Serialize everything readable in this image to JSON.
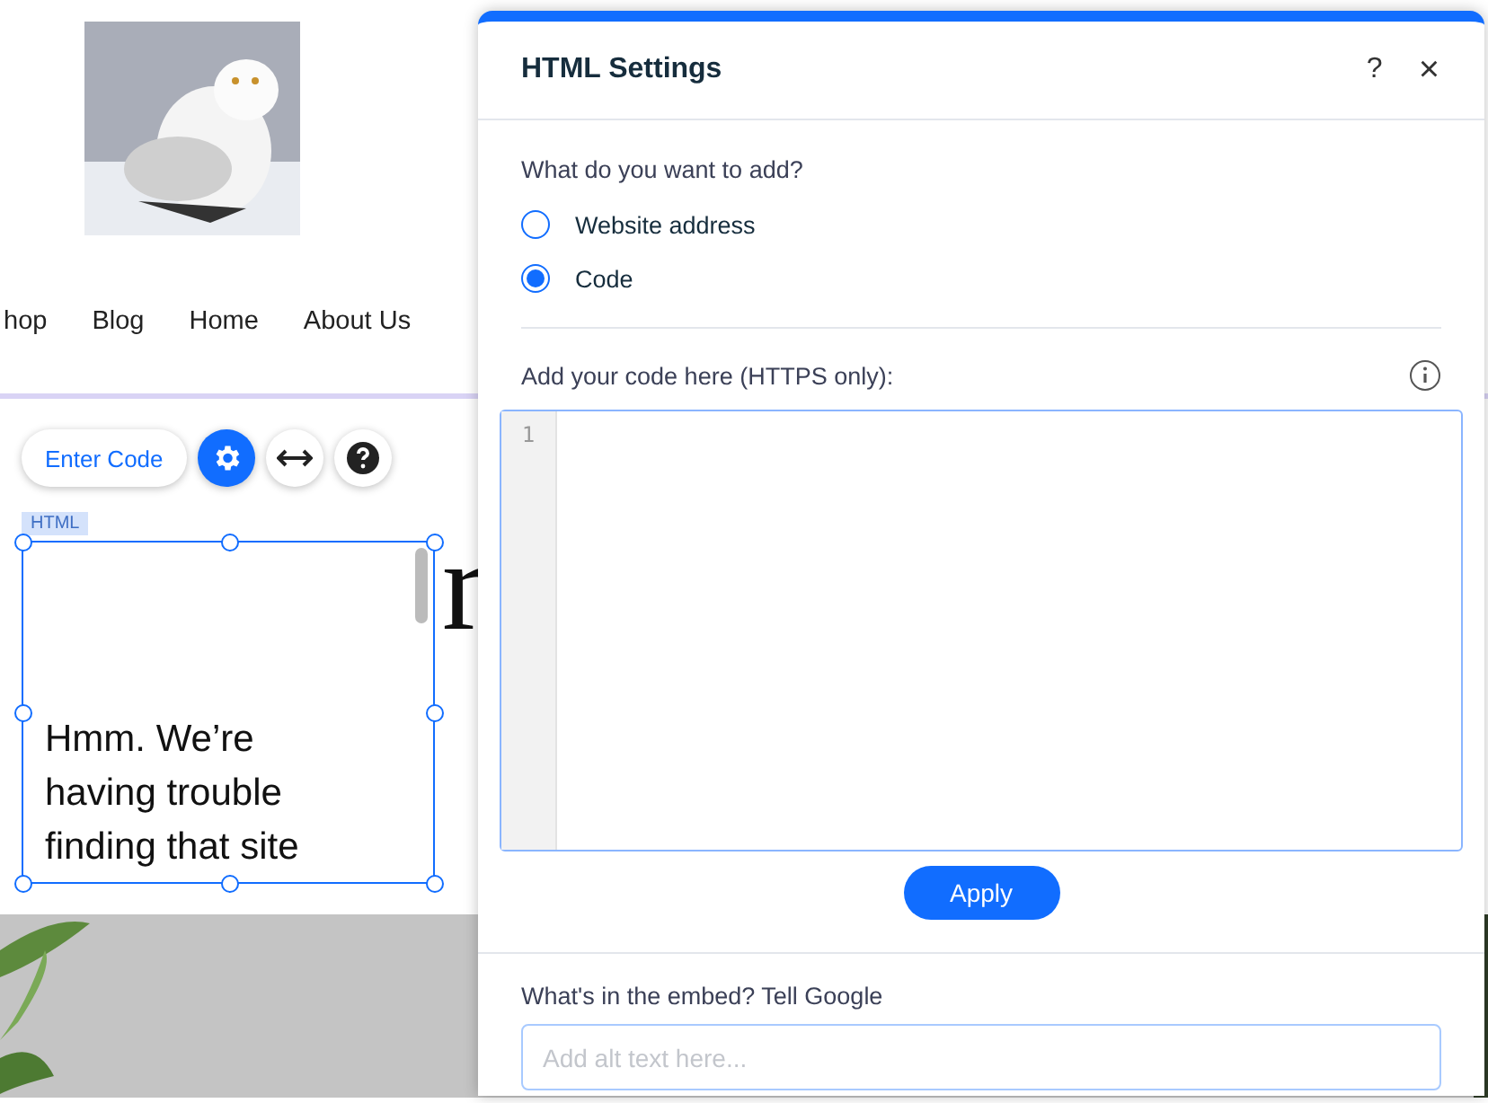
{
  "site": {
    "nav": [
      "hop",
      "Blog",
      "Home",
      "About Us"
    ],
    "heading_fragments": [
      "r"
    ],
    "toolbar": {
      "button": "Enter Code"
    },
    "html_element": {
      "tag": "HTML",
      "message": "Hmm. We’re having trouble finding that site"
    }
  },
  "panel": {
    "title": "HTML Settings",
    "help": "?",
    "close": "×",
    "question": "What do you want to add?",
    "options": [
      {
        "label": "Website address",
        "selected": false
      },
      {
        "label": "Code",
        "selected": true
      }
    ],
    "code_label": "Add your code here (HTTPS only):",
    "line_numbers": [
      "1"
    ],
    "apply": "Apply",
    "alt_label": "What's in the embed? Tell Google",
    "alt_placeholder": "Add alt text here..."
  }
}
